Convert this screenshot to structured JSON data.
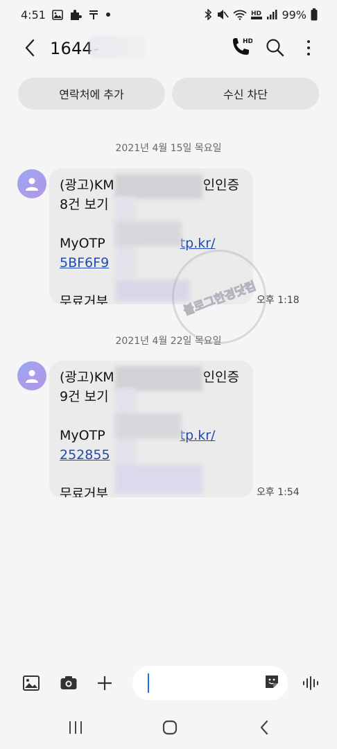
{
  "status_bar": {
    "time": "4:51",
    "battery": "99%"
  },
  "header": {
    "contact": "1644-",
    "call_icon_badge": "HD"
  },
  "actions": {
    "add_contact": "연락처에 추가",
    "block": "수신 차단"
  },
  "messages": [
    {
      "date": "2021년 4월 15일 목요일",
      "line1_start": "(광고)KM",
      "line1_end": "인인증",
      "line2": "8건 보기",
      "line3_start": "MyOTP",
      "line3_link": "tp.kr/",
      "line4_link": "5BF6F9",
      "line5": "무료거부",
      "time": "오후 1:18"
    },
    {
      "date": "2021년 4월 22일 목요일",
      "line1_start": "(광고)KM",
      "line1_end": "인인증",
      "line2": "9건 보기",
      "line3_start": "MyOTP",
      "line3_link": "tp.kr/",
      "line4_link": "252855",
      "line5": "무료거부",
      "time": "오후 1:54"
    }
  ],
  "watermark": {
    "text": "블로그한경닷컴"
  },
  "composer": {
    "placeholder": ""
  },
  "colors": {
    "link": "#1f49b5",
    "bubble": "#ebebeb",
    "avatar_start": "#9aa7f0",
    "avatar_end": "#b695e8",
    "cursor": "#1b6ef2"
  },
  "icons": {
    "status_left": [
      "gallery-icon",
      "puzzle-icon",
      "tmap-icon",
      "dot-icon"
    ],
    "status_right": [
      "bluetooth-icon",
      "mute-icon",
      "wifi-icon",
      "hd-voice-icon",
      "signal-icon",
      "battery-icon"
    ],
    "composer": [
      "image-icon",
      "camera-icon",
      "plus-icon",
      "sticker-icon",
      "voice-icon"
    ],
    "nav": [
      "recents-icon",
      "home-icon",
      "back-icon"
    ]
  }
}
